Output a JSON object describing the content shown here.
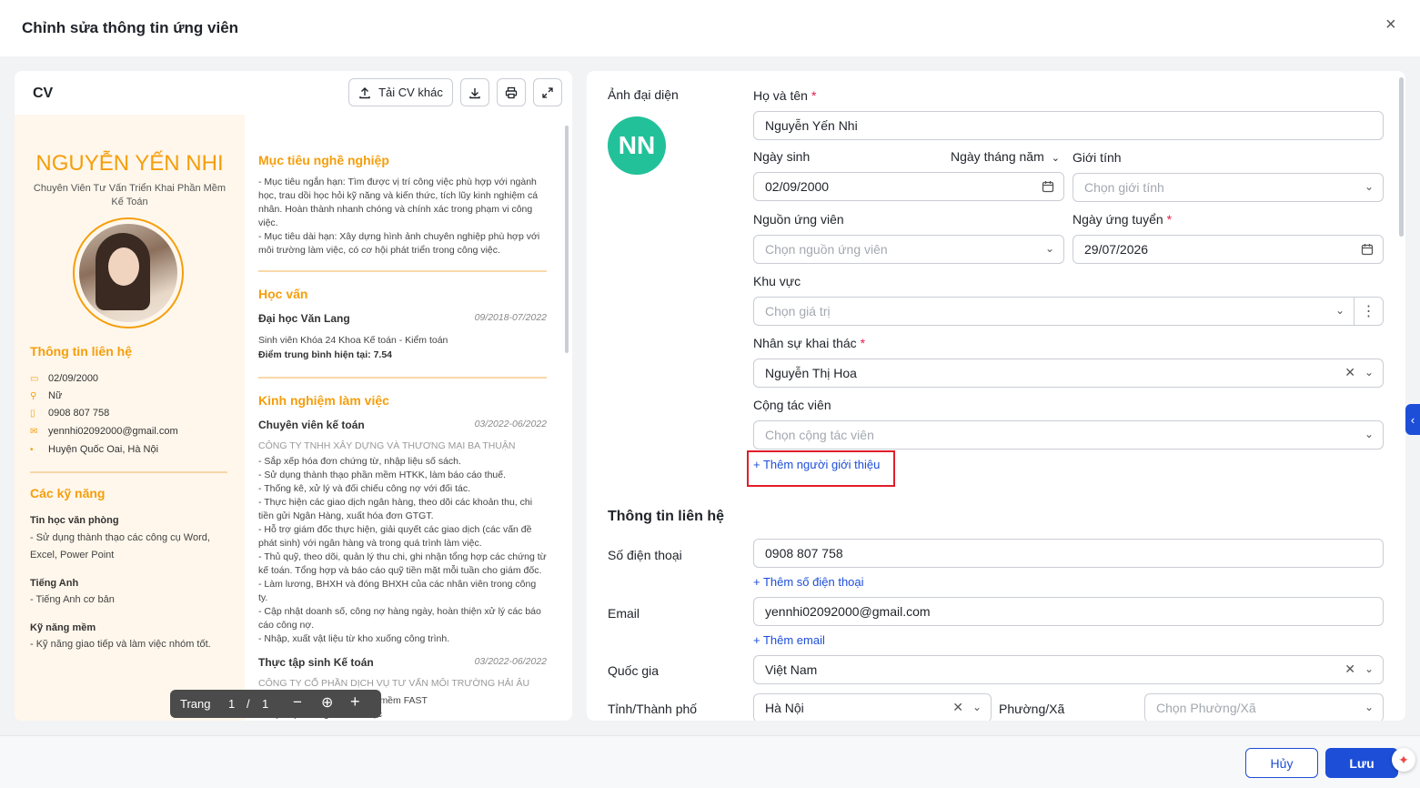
{
  "dialog": {
    "title": "Chỉnh sửa thông tin ứng viên",
    "close_icon": "×"
  },
  "cv_panel": {
    "label": "CV",
    "upload_label": "Tải CV khác",
    "pager": {
      "label": "Trang",
      "page": "1",
      "sep": "/",
      "total": "1"
    },
    "doc": {
      "name": "NGUYỄN YẾN NHI",
      "job_title": "Chuyên Viên Tư Vấn Triển Khai Phần Mềm Kế Toán",
      "contact_head": "Thông tin liên hệ",
      "contact": [
        "02/09/2000",
        "Nữ",
        "0908 807 758",
        "yennhi02092000@gmail.com",
        "Huyện Quốc Oai, Hà Nội"
      ],
      "skills_head": "Các kỹ năng",
      "skills": [
        {
          "title": "Tin học văn phòng",
          "text": "- Sử dụng thành thạo các công cụ Word, Excel, Power Point"
        },
        {
          "title": "Tiếng Anh",
          "text": "- Tiếng Anh cơ bản"
        },
        {
          "title": "Kỹ năng mềm",
          "text": "- Kỹ năng giao tiếp và làm việc nhóm tốt."
        }
      ],
      "objective_head": "Mục tiêu nghề nghiệp",
      "objective_text": "- Mục tiêu ngắn hạn: Tìm được vị trí công việc phù hợp với ngành học, trau dồi học hỏi kỹ năng và kiến thức, tích lũy kinh nghiệm cá nhân. Hoàn thành nhanh chóng và chính xác trong phạm vi công việc.\n - Mục tiêu dài hạn: Xây dựng hình ảnh chuyên nghiệp phù hợp với môi trường làm việc, có cơ hội phát triển trong công việc.",
      "edu_head": "Học vấn",
      "edu": {
        "school": "Đại học Văn Lang",
        "date": "09/2018-07/2022",
        "line1": "Sinh viên Khóa 24 Khoa Kế toán - Kiểm toán",
        "line2": "Điểm trung bình hiện tại: 7.54"
      },
      "exp_head": "Kinh nghiệm làm việc",
      "exp1": {
        "role": "Chuyên viên kế toán",
        "date": "03/2022-06/2022",
        "company": "CÔNG TY TNHH XÂY DỰNG VÀ THƯƠNG MẠI BA THUẬN",
        "text": "- Sắp xếp hóa đơn chứng từ, nhập liệu số sách.\n - Sử dụng thành thạo phần mềm HTKK, làm báo cáo thuế.\n - Thống kê, xử lý và đối chiếu công nợ với đối tác.\n - Thực hiện các giao dịch ngân hàng, theo dõi các khoản thu, chi tiền gửi Ngân Hàng, xuất hóa đơn GTGT.\n - Hỗ trợ giám đốc thực hiện, giải quyết các giao dịch (các vấn đề phát sinh) với ngân hàng và trong quá trình làm việc.\n - Thủ quỹ, theo dõi, quản lý thu chi, ghi nhận tổng hợp các chứng từ kế toán. Tổng hợp và báo cáo quỹ tiền mặt mỗi tuần cho giám đốc.\n - Làm lương, BHXH và đóng BHXH của các nhân viên trong công ty.\n - Cập nhật doanh số, công nợ hàng ngày, hoàn thiện xử lý các báo cáo công nợ.\n - Nhập, xuất vật liệu từ kho xuống công trình."
      },
      "exp2": {
        "role": "Thực tập sinh Kế toán",
        "date": "03/2022-06/2022",
        "company": "CÔNG TY CỔ PHẦN DỊCH VỤ TƯ VẤN MÔI TRƯỜNG HẢI ÂU",
        "text": "- Hỗ trợ nhập hóa đơn phần mềm FAST\n - Sắp xếp chứng từ khoa học"
      }
    }
  },
  "form": {
    "avatar_label": "Ảnh đại diện",
    "avatar_initials": "NN",
    "name_label": "Họ và tên",
    "name_value": "Nguyễn Yến Nhi",
    "dob_label": "Ngày sinh",
    "dob_format": "Ngày tháng năm",
    "dob_value": "02/09/2000",
    "gender_label": "Giới tính",
    "gender_placeholder": "Chọn giới tính",
    "source_label": "Nguồn ứng viên",
    "source_placeholder": "Chọn nguồn ứng viên",
    "apply_label": "Ngày ứng tuyển",
    "apply_value": "29/07/2026",
    "region_label": "Khu vực",
    "region_placeholder": "Chọn giá trị",
    "recruiter_label": "Nhân sự khai thác",
    "recruiter_value": "Nguyễn Thị Hoa",
    "collab_label": "Cộng tác viên",
    "collab_placeholder": "Chọn cộng tác viên",
    "add_referrer": "+ Thêm người giới thiệu",
    "contact_section": "Thông tin liên hệ",
    "phone_label": "Số điện thoại",
    "phone_value": "0908 807 758",
    "add_phone": "+ Thêm số điện thoại",
    "email_label": "Email",
    "email_value": "yennhi02092000@gmail.com",
    "add_email": "+ Thêm email",
    "country_label": "Quốc gia",
    "country_value": "Việt Nam",
    "city_label": "Tỉnh/Thành phố",
    "city_value": "Hà Nội",
    "ward_label": "Phường/Xã",
    "ward_placeholder": "Chọn Phường/Xã"
  },
  "footer": {
    "cancel": "Hủy",
    "save": "Lưu"
  },
  "colors": {
    "accent": "#1d4ed8",
    "cv_orange": "#f59e0b",
    "avatar_green": "#22c19a",
    "highlight_red": "#e11d2b"
  }
}
